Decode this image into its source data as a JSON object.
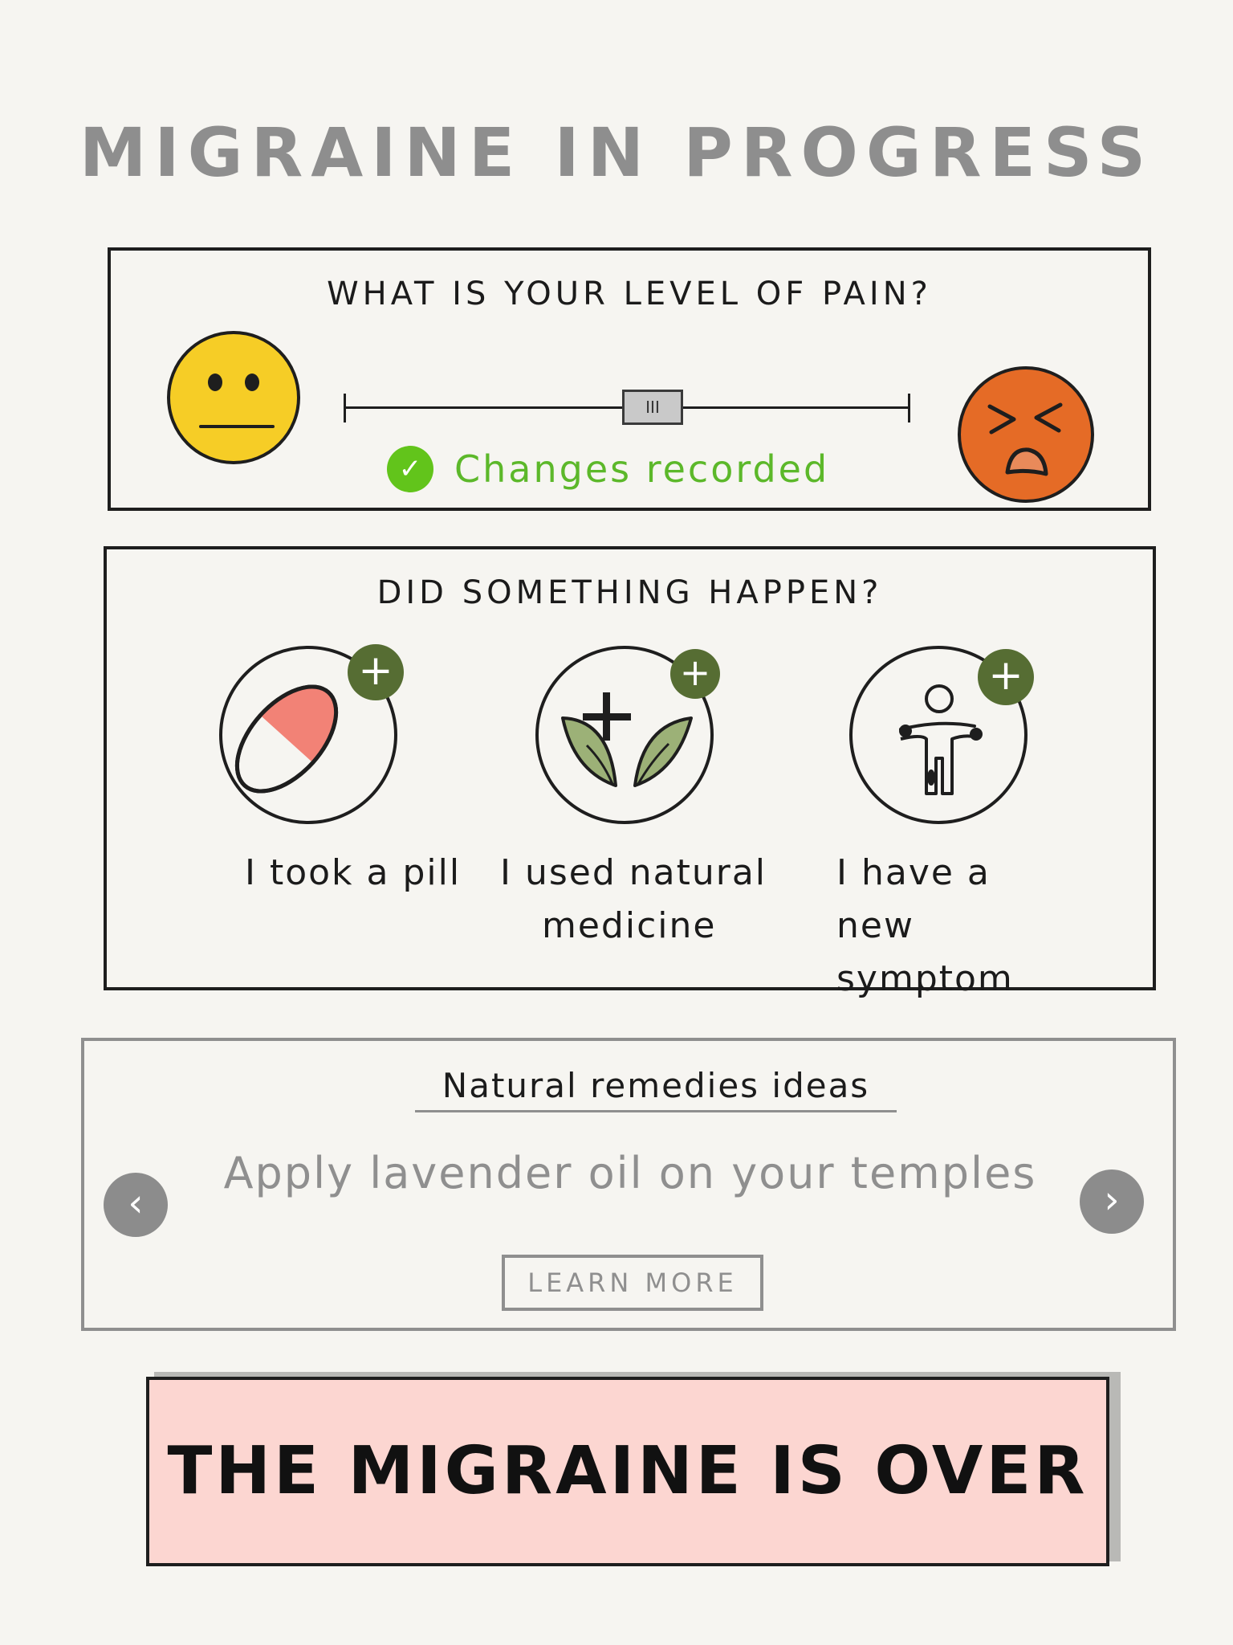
{
  "page": {
    "title": "MIGRAINE IN PROGRESS"
  },
  "pain": {
    "question": "WHAT IS YOUR LEVEL OF PAIN?",
    "level": 0.55,
    "thumb_label": "III",
    "status_text": "Changes recorded",
    "low_icon": "neutral-face-icon",
    "high_icon": "pained-face-icon"
  },
  "events": {
    "question": "DID SOMETHING HAPPEN?",
    "options": [
      {
        "line1": "I took a pill",
        "line2": "",
        "icon": "pill-icon"
      },
      {
        "line1": "I used natural",
        "line2": "medicine",
        "icon": "leaves-plus-icon"
      },
      {
        "line1": "I have a",
        "line2": "new symptom",
        "icon": "body-icon"
      }
    ],
    "add_icon": "plus-icon"
  },
  "remedies": {
    "title": "Natural remedies ideas",
    "tip": "Apply lavender oil on your temples",
    "learn_more": "LEARN MORE",
    "prev_icon": "chevron-left-icon",
    "next_icon": "chevron-right-icon"
  },
  "actions": {
    "end_label": "THE MIGRAINE IS OVER"
  },
  "colors": {
    "neutral_face": "#f6cd26",
    "pain_face": "#e56b26",
    "success": "#62c41b",
    "badge": "#566d33",
    "end_button": "#fcd6d1"
  }
}
